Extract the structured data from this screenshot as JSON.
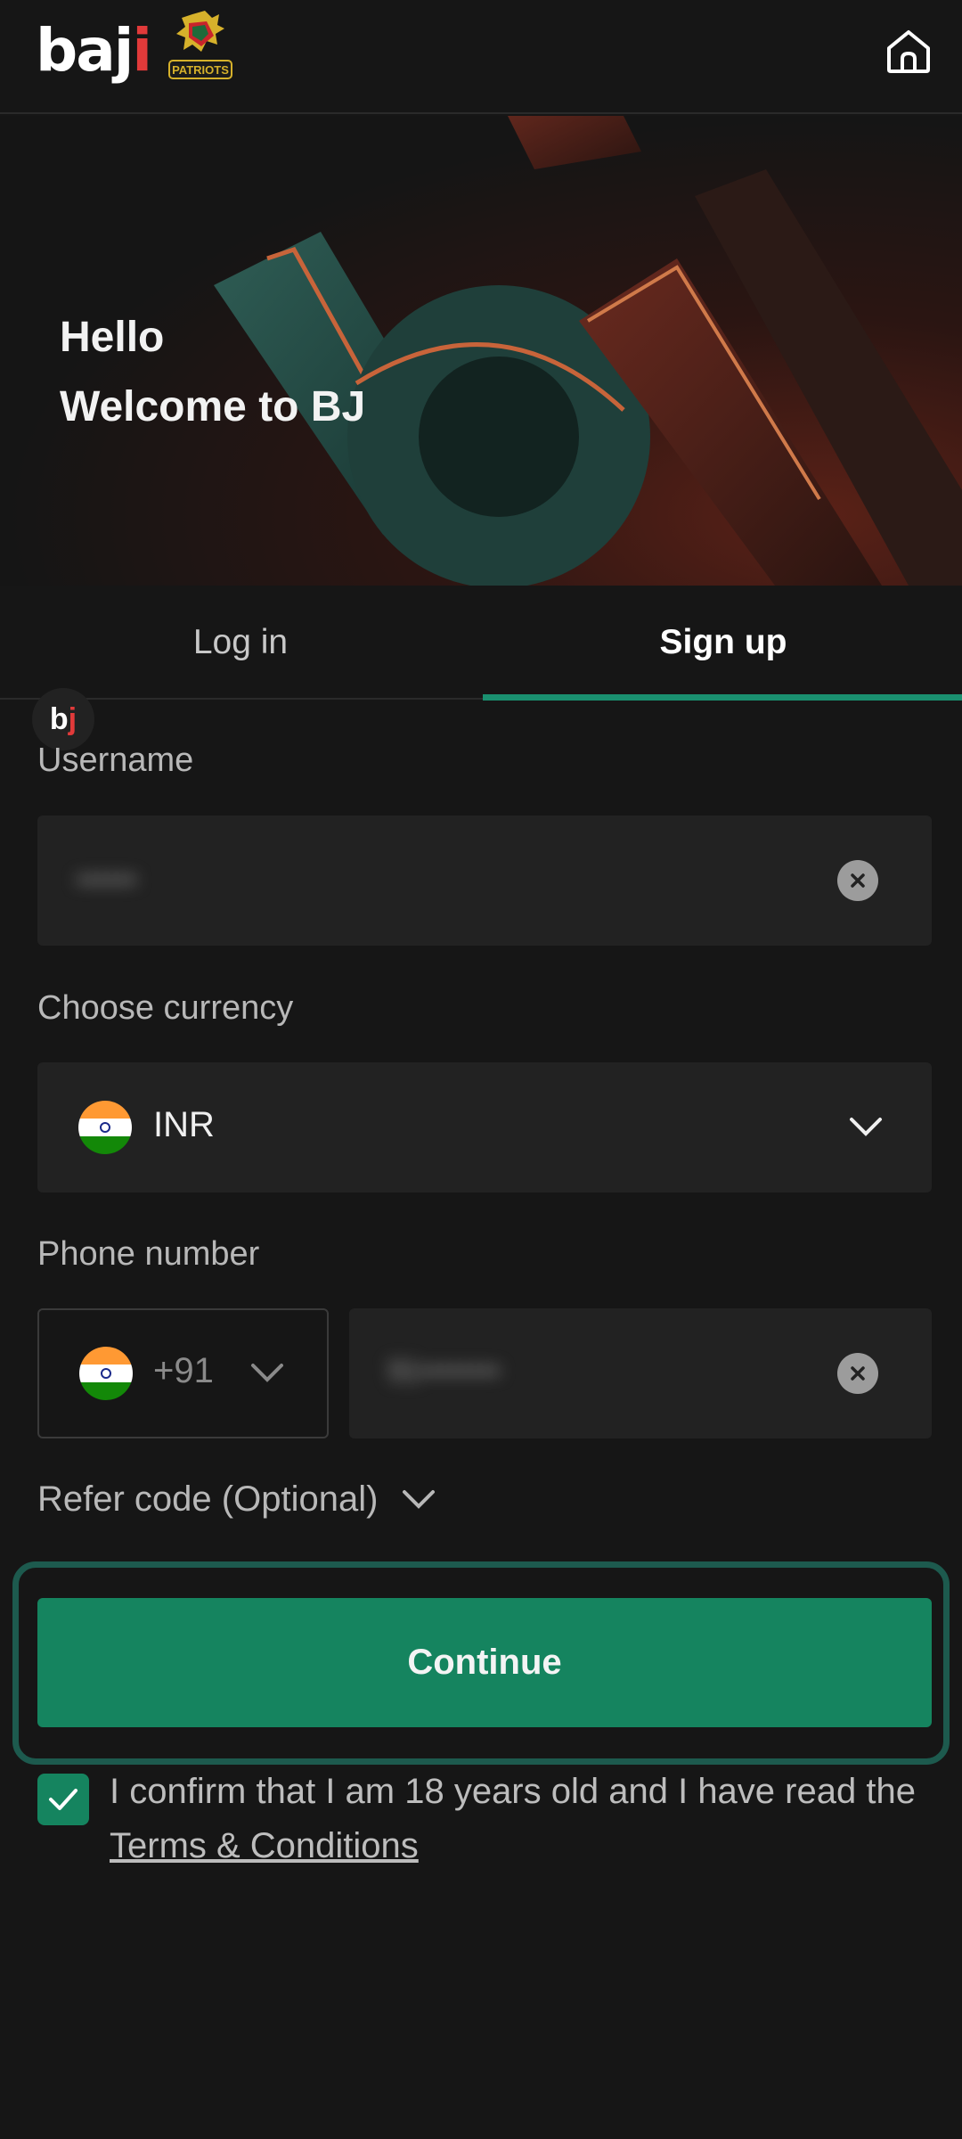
{
  "header": {
    "logo_text_main": "baj",
    "logo_text_i": "i",
    "partner_logo": "PATRIOTS",
    "home_icon": "home-icon"
  },
  "banner": {
    "line1": "Hello",
    "line2": "Welcome to BJ"
  },
  "tabs": [
    {
      "label": "Log in",
      "active": false
    },
    {
      "label": "Sign up",
      "active": true
    }
  ],
  "badge": {
    "main": "b",
    "accent": "j"
  },
  "form": {
    "username": {
      "label": "Username",
      "value": "••••••"
    },
    "currency": {
      "label": "Choose currency",
      "value": "INR",
      "flag": "india-flag"
    },
    "phone": {
      "label": "Phone number",
      "country_code": "+91",
      "value": "91••••••••"
    },
    "refer": {
      "label": "Refer code (Optional)"
    }
  },
  "continue_label": "Continue",
  "confirm": {
    "checked": true,
    "text_before": "I confirm that I am 18 years old and I have read the ",
    "link": "Terms & Conditions"
  },
  "colors": {
    "accent": "#15845f",
    "tab_underline": "#1a9070",
    "background": "#161616",
    "field": "#222222"
  }
}
